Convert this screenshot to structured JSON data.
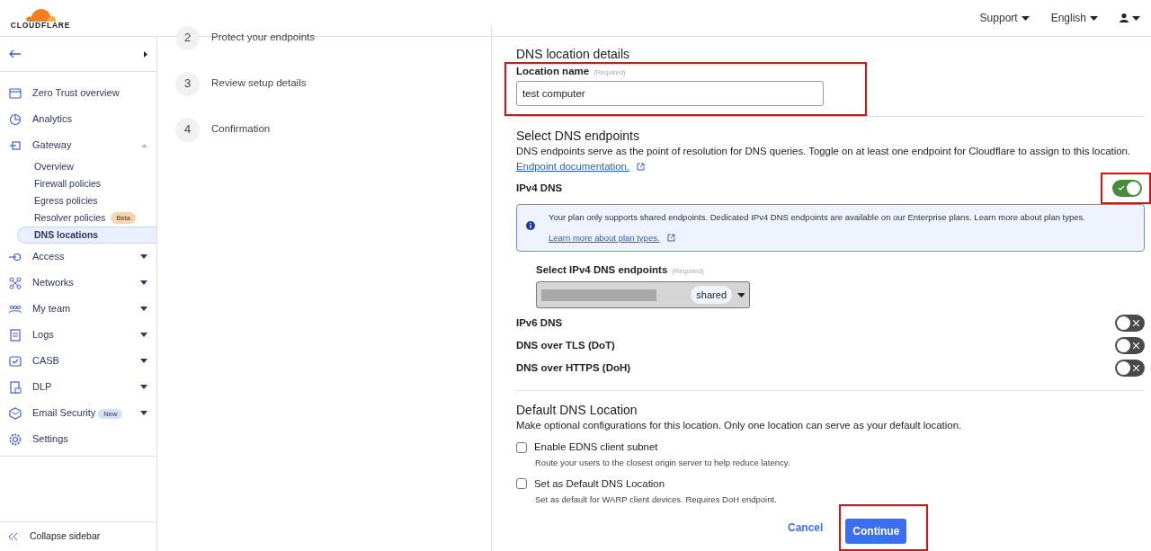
{
  "header": {
    "logo": "CLOUDFLARE",
    "menus": [
      {
        "label": "Support"
      },
      {
        "label": "English"
      }
    ]
  },
  "sidebar": {
    "items": [
      {
        "label": "Zero Trust overview",
        "kind": "link"
      },
      {
        "label": "Analytics",
        "kind": "link"
      },
      {
        "label": "Gateway",
        "kind": "group",
        "expanded": true,
        "children": [
          {
            "label": "Overview",
            "selected": false
          },
          {
            "label": "Firewall policies",
            "selected": false
          },
          {
            "label": "Egress policies",
            "selected": false
          },
          {
            "label": "Resolver policies",
            "selected": false,
            "badge": {
              "text": "Beta",
              "color": "#f6d6ad"
            }
          },
          {
            "label": "DNS locations",
            "selected": true
          }
        ]
      },
      {
        "label": "Access",
        "kind": "group",
        "expanded": false
      },
      {
        "label": "Networks",
        "kind": "group",
        "expanded": false
      },
      {
        "label": "My team",
        "kind": "group",
        "expanded": false
      },
      {
        "label": "Logs",
        "kind": "group",
        "expanded": false
      },
      {
        "label": "CASB",
        "kind": "group",
        "expanded": false
      },
      {
        "label": "DLP",
        "kind": "group",
        "expanded": false
      },
      {
        "label": "Email Security",
        "kind": "group",
        "expanded": false,
        "badge": {
          "text": "New",
          "color": "#d6e2fb"
        }
      },
      {
        "label": "Settings",
        "kind": "link"
      }
    ],
    "collapse": "Collapse sidebar"
  },
  "steps": [
    {
      "number": "2",
      "label": "Protect your endpoints"
    },
    {
      "number": "3",
      "label": "Review setup details"
    },
    {
      "number": "4",
      "label": "Confirmation"
    }
  ],
  "location": {
    "title": "DNS location details",
    "label": "Location name",
    "required": "(Required)",
    "value": "test computer",
    "highlighted": true
  },
  "endpoints": {
    "title": "Select DNS endpoints",
    "description": "DNS endpoints serve as the point of resolution for DNS queries. Toggle on at least one endpoint for Cloudflare to assign to this location.",
    "link": "Endpoint documentation.",
    "items": [
      {
        "label": "IPv4 DNS",
        "on": true,
        "highlighted": true,
        "alert": {
          "text": "Your plan only supports shared endpoints. Dedicated IPv4 DNS endpoints are available on our Enterprise plans. Learn more about plan types.",
          "link": "Learn more about plan types."
        },
        "select": {
          "label": "Select IPv4 DNS endpoints",
          "required": "(Required)",
          "tag": "shared"
        }
      },
      {
        "label": "IPv6 DNS",
        "on": false,
        "highlighted": false
      },
      {
        "label": "DNS over TLS (DoT)",
        "on": false,
        "highlighted": false
      },
      {
        "label": "DNS over HTTPS (DoH)",
        "on": false,
        "highlighted": false
      }
    ]
  },
  "default_location": {
    "title": "Default DNS Location",
    "description": "Make optional configurations for this location. Only one location can serve as your default location.",
    "options": [
      {
        "label": "Enable EDNS client subnet",
        "hint": "Route your users to the closest origin server to help reduce latency.",
        "checked": false
      },
      {
        "label": "Set as Default DNS Location",
        "hint": "Set as default for WARP client devices. Requires DoH endpoint.",
        "checked": false
      }
    ]
  },
  "actions": {
    "cancel": "Cancel",
    "continue": "Continue",
    "continue_highlighted": true
  }
}
